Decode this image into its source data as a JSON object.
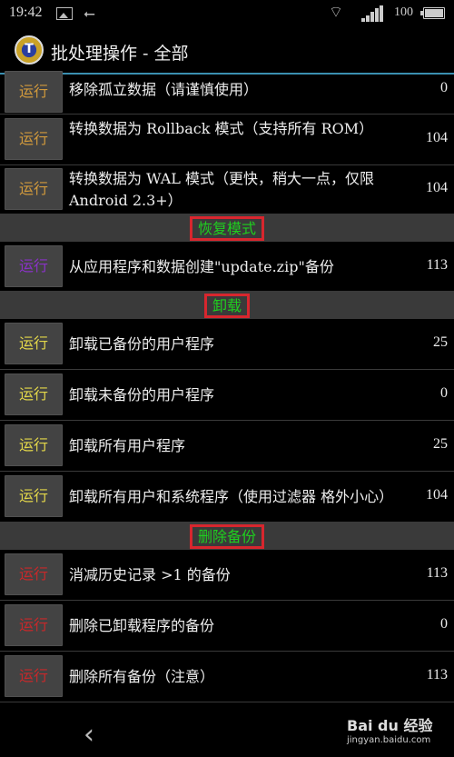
{
  "statusbar": {
    "time": "19:42",
    "battery_level": "100",
    "icons": [
      "image-icon",
      "usb-icon",
      "wifi-icon",
      "signal-icon",
      "battery-icon"
    ]
  },
  "actionbar": {
    "app_icon_glyph": "T",
    "title": "批处理操作 - 全部"
  },
  "colors": {
    "orange": "#d29a3c",
    "yellow": "#e3d74a",
    "purple": "#8a32c8",
    "red": "#c8282a",
    "section_text": "#1fcf1f",
    "highlight_box": "#d8262e",
    "accent_line": "#3a8fb0"
  },
  "groups": [
    {
      "rows": [
        {
          "button": "运行",
          "label": "移除孤立数据（请谨慎使用）",
          "count": "0"
        },
        {
          "button": "运行",
          "label": "转换数据为 Rollback 模式（支持所有 ROM）",
          "count": "104"
        },
        {
          "button": "运行",
          "label": "转换数据为 WAL 模式（更快，稍大一点，仅限 Android 2.3+）",
          "count": "104"
        }
      ]
    },
    {
      "section": "恢复模式",
      "rows": [
        {
          "button": "运行",
          "label": "从应用程序和数据创建\"update.zip\"备份",
          "count": "113"
        }
      ]
    },
    {
      "section": "卸载",
      "rows": [
        {
          "button": "运行",
          "label": "卸载已备份的用户程序",
          "count": "25"
        },
        {
          "button": "运行",
          "label": "卸载未备份的用户程序",
          "count": "0"
        },
        {
          "button": "运行",
          "label": "卸载所有用户程序",
          "count": "25"
        },
        {
          "button": "运行",
          "label": "卸载所有用户和系统程序（使用过滤器 格外小心）",
          "count": "104"
        }
      ]
    },
    {
      "section": "删除备份",
      "rows": [
        {
          "button": "运行",
          "label": "消减历史记录 >1 的备份",
          "count": "113"
        },
        {
          "button": "运行",
          "label": "删除已卸载程序的备份",
          "count": "0"
        },
        {
          "button": "运行",
          "label": "删除所有备份（注意）",
          "count": "113"
        }
      ]
    }
  ],
  "navbar": {
    "back_icon": "‹"
  },
  "watermark": {
    "brand": "Bai du 经验",
    "url": "jingyan.baidu.com"
  }
}
